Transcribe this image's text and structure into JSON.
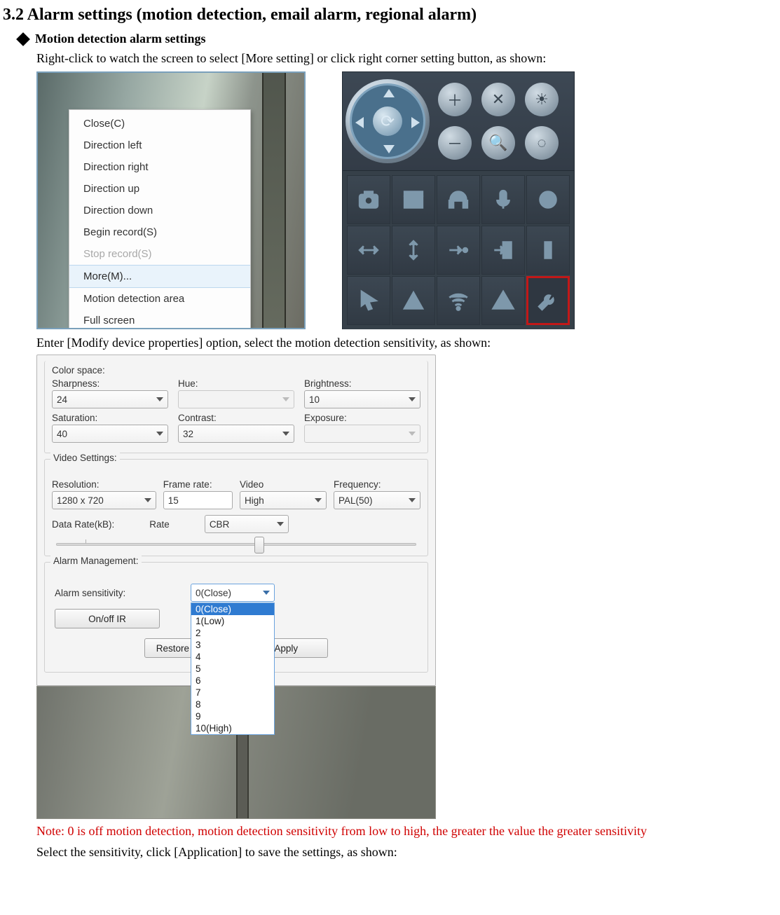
{
  "section_title": "3.2 Alarm settings (motion detection, email alarm, regional alarm)",
  "bullet_heading": "Motion detection alarm settings",
  "text_line1": "Right-click to watch the screen to select [More setting] or click right corner setting button, as shown:",
  "text_line2": "Enter [Modify device properties] option, select the motion detection sensitivity, as shown:",
  "text_note": "Note: 0 is off motion detection, motion detection sensitivity from low to high, the greater the value the greater sensitivity",
  "text_line3": "Select the sensitivity, click [Application] to save the settings, as shown:",
  "context_menu": {
    "items": [
      "Close(C)",
      "Direction left",
      "Direction right",
      "Direction up",
      "Direction down",
      "Begin record(S)",
      "Stop record(S)",
      "More(M)...",
      "Motion detection area",
      "Full screen"
    ],
    "disabled_index": 6,
    "selected_index": 7
  },
  "panel": {
    "small_buttons": [
      "zoom-in",
      "close",
      "brightness-high",
      "zoom-out",
      "search",
      "brightness-low"
    ],
    "grid_icons": [
      "camera",
      "clapper",
      "headphones",
      "mic",
      "power",
      "h-arrows",
      "v-arrows",
      "step-right",
      "login",
      "bar",
      "cursor",
      "triangle",
      "wifi",
      "warning",
      "wrench"
    ],
    "highlight_index": 14
  },
  "dialog": {
    "color_space_label": "Color space:",
    "sharpness_label": "Sharpness:",
    "sharpness_value": "24",
    "hue_label": "Hue:",
    "hue_value": "",
    "brightness_label": "Brightness:",
    "brightness_value": "10",
    "saturation_label": "Saturation:",
    "saturation_value": "40",
    "contrast_label": "Contrast:",
    "contrast_value": "32",
    "exposure_label": "Exposure:",
    "exposure_value": "",
    "video_settings_label": "Video Settings:",
    "resolution_label": "Resolution:",
    "resolution_value": "1280 x 720",
    "frame_rate_label": "Frame rate:",
    "frame_rate_value": "15",
    "video_label": "Video",
    "video_value": "High",
    "frequency_label": "Frequency:",
    "frequency_value": "PAL(50)",
    "data_rate_label": "Data Rate(kB):",
    "rate_label": "Rate",
    "rate_value": "CBR",
    "alarm_mgmt_label": "Alarm Management:",
    "alarm_sens_label": "Alarm sensitivity:",
    "alarm_sens_selected": "0(Close)",
    "alarm_options": [
      "0(Close)",
      "1(Low)",
      "2",
      "3",
      "4",
      "5",
      "6",
      "7",
      "8",
      "9",
      "10(High)"
    ],
    "onoff_ir_label": "On/off IR",
    "restore_label": "Restore Defaults",
    "apply_label": "Apply"
  }
}
